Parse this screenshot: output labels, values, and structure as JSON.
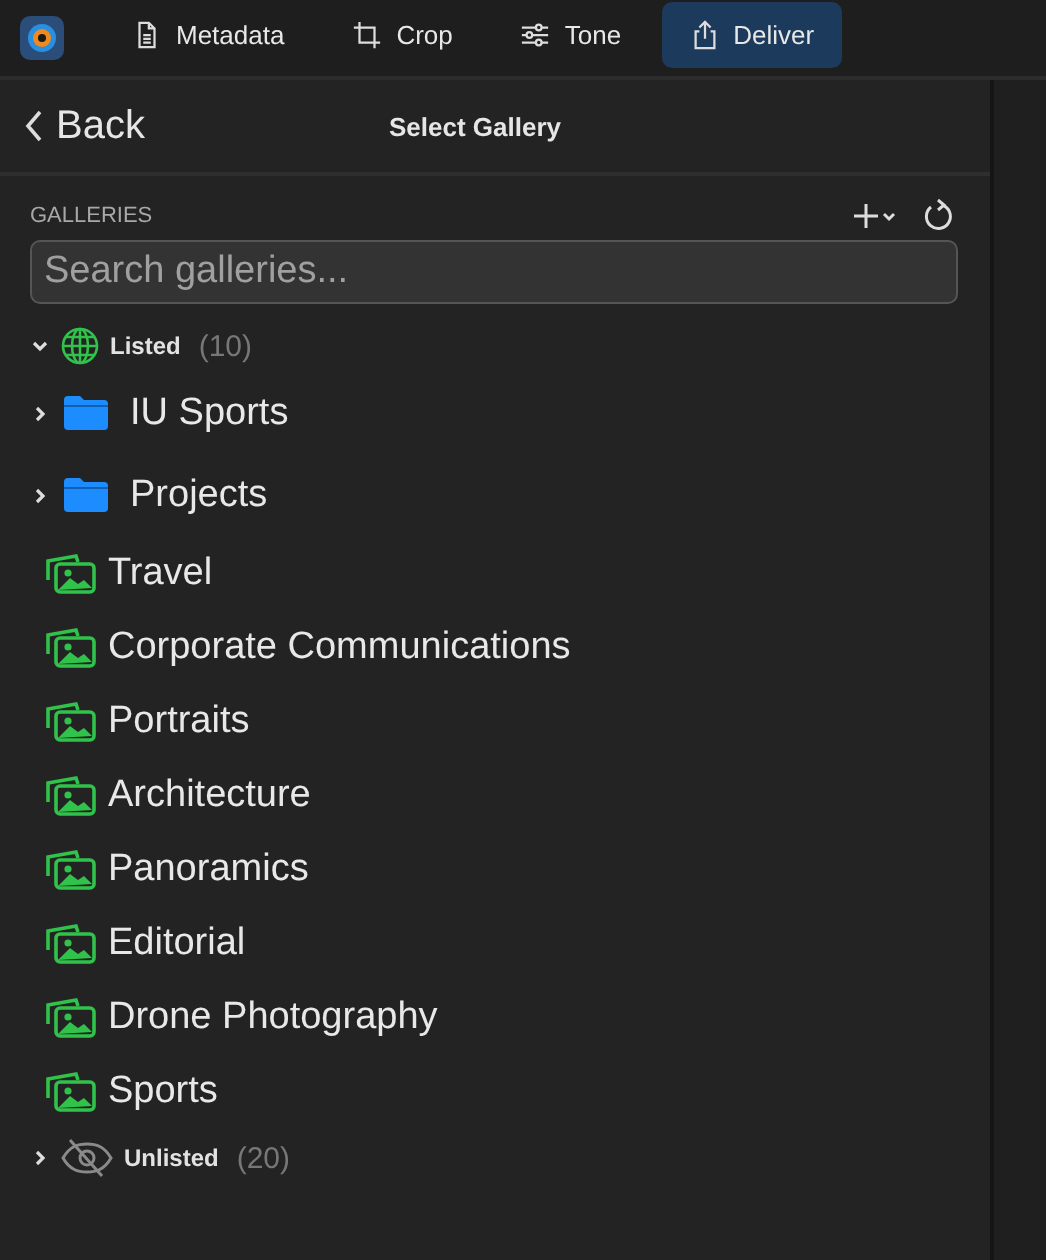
{
  "toolbar": {
    "tabs": [
      {
        "label": "Metadata",
        "kind": "document",
        "selected": false
      },
      {
        "label": "Crop",
        "kind": "crop",
        "selected": false
      },
      {
        "label": "Tone",
        "kind": "sliders",
        "selected": false
      },
      {
        "label": "Deliver",
        "kind": "share",
        "selected": true
      }
    ]
  },
  "header": {
    "back": "Back",
    "title": "Select Gallery"
  },
  "galleries": {
    "heading": "GALLERIES",
    "search": {
      "placeholder": "Search galleries..."
    },
    "sections": [
      {
        "kind": "listed",
        "label": "Listed",
        "count": "(10)",
        "expanded": true,
        "children": [
          {
            "kind": "folder",
            "label": "IU Sports",
            "expanded": false
          },
          {
            "kind": "folder",
            "label": "Projects",
            "expanded": false
          },
          {
            "kind": "gallery",
            "label": "Travel"
          },
          {
            "kind": "gallery",
            "label": "Corporate Communications"
          },
          {
            "kind": "gallery",
            "label": "Portraits"
          },
          {
            "kind": "gallery",
            "label": "Architecture"
          },
          {
            "kind": "gallery",
            "label": "Panoramics"
          },
          {
            "kind": "gallery",
            "label": "Editorial"
          },
          {
            "kind": "gallery",
            "label": "Drone Photography"
          },
          {
            "kind": "gallery",
            "label": "Sports"
          }
        ]
      },
      {
        "kind": "unlisted",
        "label": "Unlisted",
        "count": "(20)",
        "expanded": false
      }
    ]
  }
}
